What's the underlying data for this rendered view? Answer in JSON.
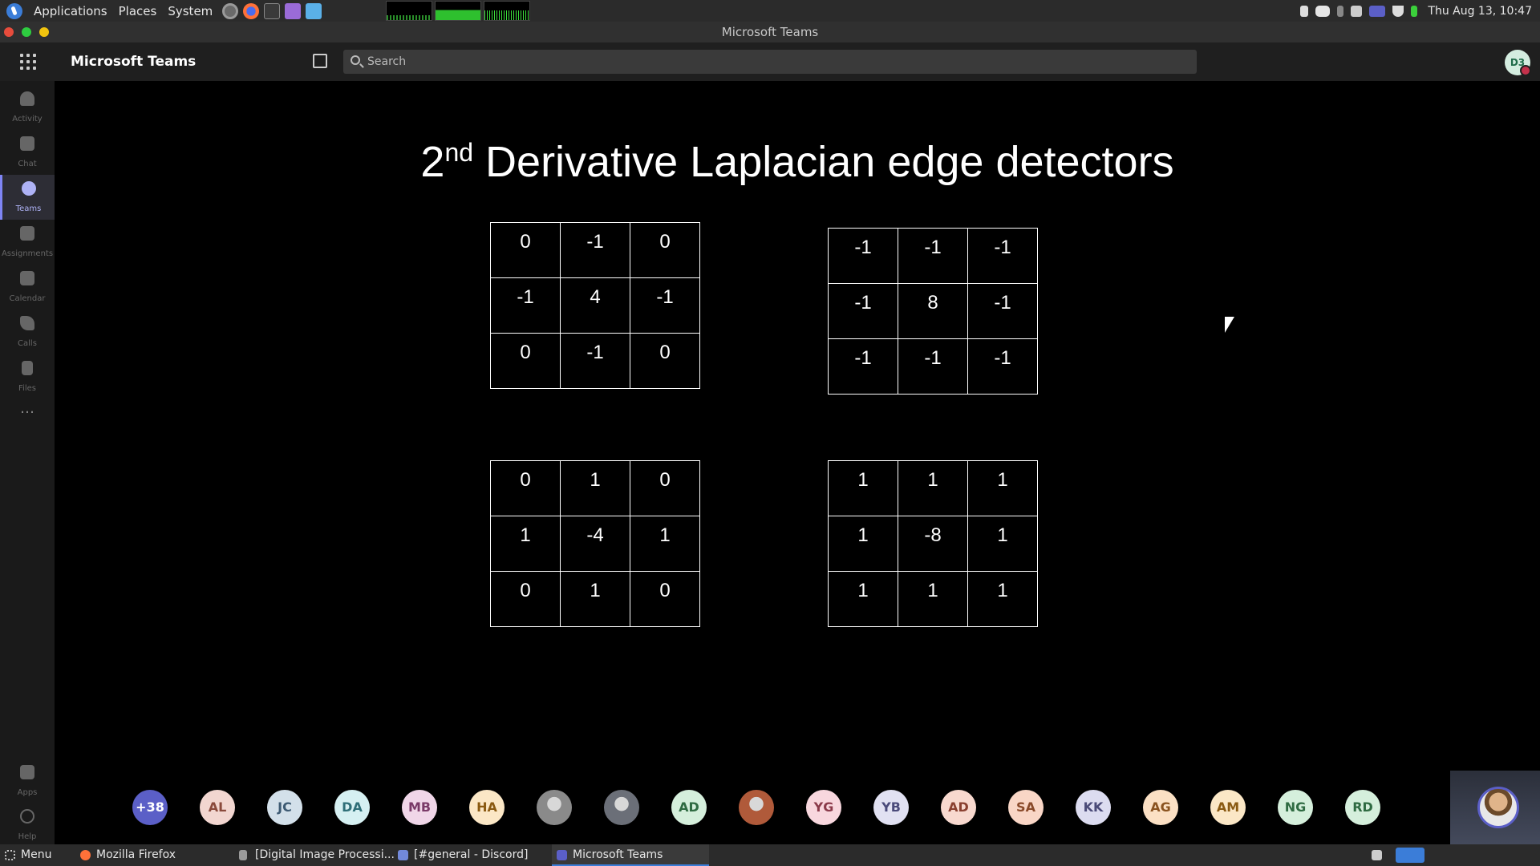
{
  "system_panel": {
    "menus": [
      "Applications",
      "Places",
      "System"
    ],
    "clock": "Thu Aug 13, 10:47"
  },
  "window": {
    "title": "Microsoft Teams"
  },
  "teams_header": {
    "app_name": "Microsoft Teams",
    "search_placeholder": "Search",
    "profile_initials": "D3"
  },
  "rail": {
    "items": [
      {
        "label": "Activity",
        "icon": "bell-icon"
      },
      {
        "label": "Chat",
        "icon": "chat-icon"
      },
      {
        "label": "Teams",
        "icon": "teams-icon",
        "active": true
      },
      {
        "label": "Assignments",
        "icon": "assignments-icon"
      },
      {
        "label": "Calendar",
        "icon": "calendar-icon"
      },
      {
        "label": "Calls",
        "icon": "phone-icon"
      },
      {
        "label": "Files",
        "icon": "file-icon"
      },
      {
        "label": "…",
        "icon": "more-icon"
      }
    ],
    "bottom": [
      {
        "label": "Apps",
        "icon": "apps-icon"
      },
      {
        "label": "Help",
        "icon": "help-icon"
      }
    ]
  },
  "slide": {
    "title_prefix": "2",
    "title_sup": "nd",
    "title_rest": " Derivative Laplacian edge detectors",
    "kernels": [
      [
        [
          "0",
          "-1",
          "0"
        ],
        [
          "-1",
          "4",
          "-1"
        ],
        [
          "0",
          "-1",
          "0"
        ]
      ],
      [
        [
          "-1",
          "-1",
          "-1"
        ],
        [
          "-1",
          "8",
          "-1"
        ],
        [
          "-1",
          "-1",
          "-1"
        ]
      ],
      [
        [
          "0",
          "1",
          "0"
        ],
        [
          "1",
          "-4",
          "1"
        ],
        [
          "0",
          "1",
          "0"
        ]
      ],
      [
        [
          "1",
          "1",
          "1"
        ],
        [
          "1",
          "-8",
          "1"
        ],
        [
          "1",
          "1",
          "1"
        ]
      ]
    ]
  },
  "participants": [
    {
      "label": "+38",
      "bg": "#5b5fc7",
      "fg": "#ffffff"
    },
    {
      "label": "AL",
      "bg": "#f2d6d0",
      "fg": "#8a4a3c"
    },
    {
      "label": "JC",
      "bg": "#d3e0ea",
      "fg": "#3d5a73"
    },
    {
      "label": "DA",
      "bg": "#d6f0f2",
      "fg": "#2f6f78"
    },
    {
      "label": "MB",
      "bg": "#f0d6e8",
      "fg": "#7a3a68"
    },
    {
      "label": "HA",
      "bg": "#fbe7c6",
      "fg": "#8a5a12"
    },
    {
      "label": "",
      "bg": "#8a8a8a",
      "fg": "#ffffff",
      "photo": true
    },
    {
      "label": "",
      "bg": "#6b6f78",
      "fg": "#ffffff",
      "photo": true
    },
    {
      "label": "AD",
      "bg": "#d5efdc",
      "fg": "#2f6b42"
    },
    {
      "label": "",
      "bg": "#b05a3a",
      "fg": "#ffffff",
      "photo": true
    },
    {
      "label": "YG",
      "bg": "#f8d7de",
      "fg": "#8a3a4a"
    },
    {
      "label": "YB",
      "bg": "#e1e1f2",
      "fg": "#4a4a7a"
    },
    {
      "label": "AD",
      "bg": "#f8d9cf",
      "fg": "#8a4030"
    },
    {
      "label": "SA",
      "bg": "#f9d6c6",
      "fg": "#8a4a2a"
    },
    {
      "label": "KK",
      "bg": "#dcdcf0",
      "fg": "#4a4a78"
    },
    {
      "label": "AG",
      "bg": "#fbe0c4",
      "fg": "#8a5320"
    },
    {
      "label": "AM",
      "bg": "#fbe7c6",
      "fg": "#8a5a12"
    },
    {
      "label": "NG",
      "bg": "#d5efdc",
      "fg": "#2f6b42"
    },
    {
      "label": "RD",
      "bg": "#d5efdc",
      "fg": "#2f6b42"
    }
  ],
  "taskbar": {
    "menu_label": "Menu",
    "tasks": [
      {
        "label": "Mozilla Firefox",
        "color": "#ff7139"
      },
      {
        "label": "[Digital Image Processi...",
        "color": "#9a9a9a"
      },
      {
        "label": "[#general - Discord]",
        "color": "#7289da"
      },
      {
        "label": "Microsoft Teams",
        "color": "#5b5fc7",
        "active": true
      }
    ]
  }
}
